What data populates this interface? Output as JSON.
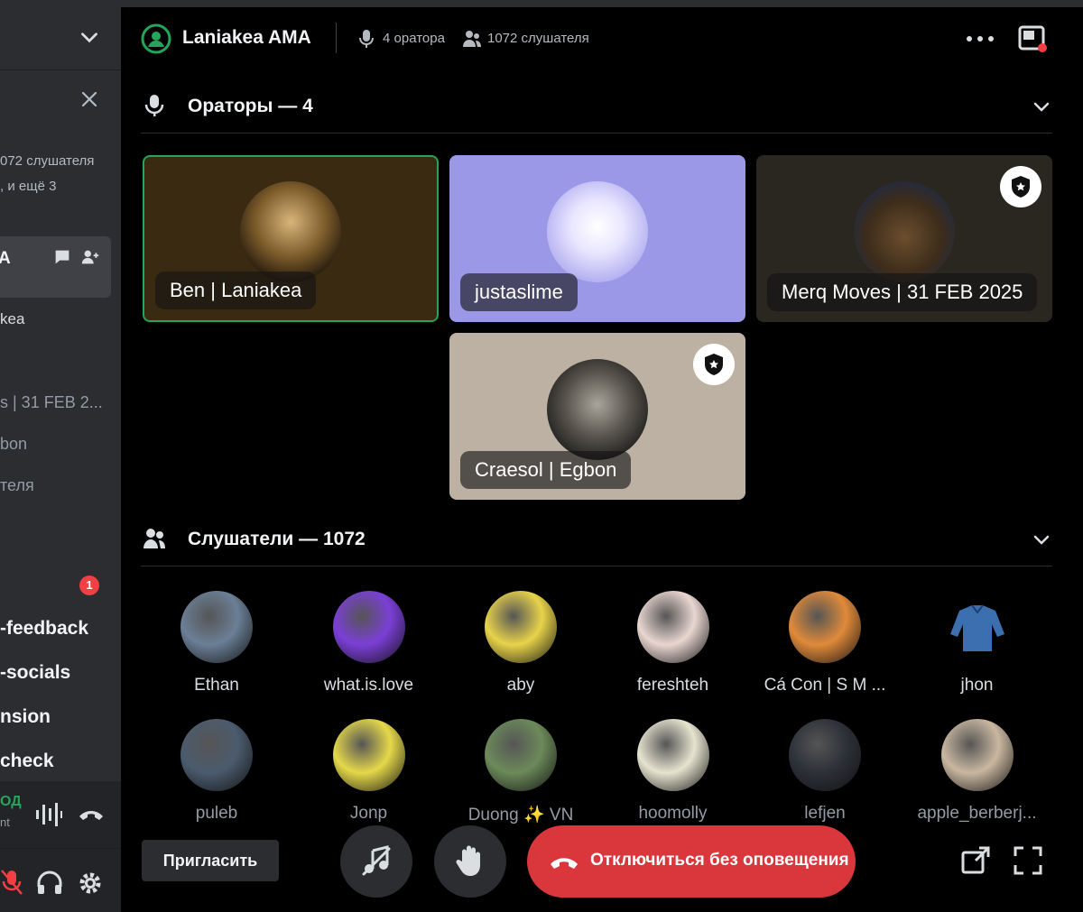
{
  "sidebar": {
    "stats_line": "072 слушателя",
    "more_line": ", и ещё 3",
    "card_letter": "A",
    "speakers": [
      "kea",
      "s | 31 FEB 2...",
      "bon",
      "теля"
    ],
    "badge_count": "1",
    "channels": [
      "-feedback",
      "-socials",
      "nsion",
      "check"
    ],
    "voice_status": "ОД",
    "voice_sub": "nt"
  },
  "header": {
    "title": "Laniakea AMA",
    "speakers_count": "4 оратора",
    "listeners_count": "1072 слушателя"
  },
  "speakers_section": {
    "label": "Ораторы — 4",
    "tiles": [
      {
        "name": "Ben | Laniakea",
        "bg": "#3a2a12",
        "moderator": false,
        "speaking": true
      },
      {
        "name": "justaslime",
        "bg": "#9b98e8",
        "moderator": false,
        "speaking": false
      },
      {
        "name": "Merq Moves | 31 FEB 2025",
        "bg": "#2a2720",
        "moderator": true,
        "speaking": false
      },
      {
        "name": "Craesol | Egbon",
        "bg": "#bcb1a3",
        "moderator": true,
        "speaking": false
      }
    ]
  },
  "listeners_section": {
    "label": "Слушатели — 1072",
    "listeners": [
      {
        "name": "Ethan",
        "color": "#6b7f96"
      },
      {
        "name": "what.is.love",
        "color": "#7b3fd6"
      },
      {
        "name": "aby",
        "color": "#e8d34a"
      },
      {
        "name": "fereshteh",
        "color": "#e9d6d0"
      },
      {
        "name": "Cá Con | S M ...",
        "color": "#e08a3a"
      },
      {
        "name": "jhon",
        "color": "#000000"
      },
      {
        "name": "puleb",
        "color": "#4b5b6e"
      },
      {
        "name": "Jonp",
        "color": "#e5d84a"
      },
      {
        "name": "Duong ✨ VN",
        "color": "#6c8a5a"
      },
      {
        "name": "hoomolly",
        "color": "#e6e3cf"
      },
      {
        "name": "lefjen",
        "color": "#2d3138"
      },
      {
        "name": "apple_berberj...",
        "color": "#c9b7a0"
      }
    ]
  },
  "controls": {
    "invite_label": "Пригласить",
    "leave_label": "Отключиться без оповещения"
  },
  "colors": {
    "accent_green": "#23a55a",
    "danger_red": "#da373c",
    "blurple": "#9b98e8"
  }
}
